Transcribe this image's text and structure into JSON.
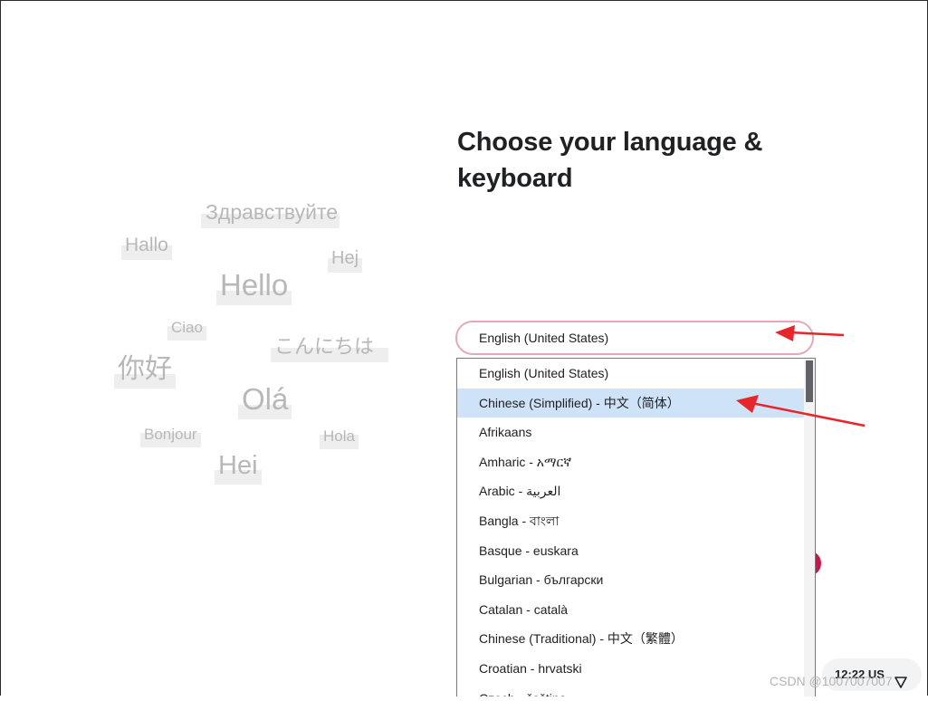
{
  "page": {
    "title": "Choose your language & keyboard"
  },
  "greetings": [
    {
      "text": "Здравствуйте"
    },
    {
      "text": "Hallo"
    },
    {
      "text": "Hej"
    },
    {
      "text": "Hello"
    },
    {
      "text": "Ciao"
    },
    {
      "text": "こんにちは"
    },
    {
      "text": "你好"
    },
    {
      "text": "Olá"
    },
    {
      "text": "Bonjour"
    },
    {
      "text": "Hola"
    },
    {
      "text": "Hei"
    }
  ],
  "language_select": {
    "value": "English (United States)"
  },
  "dropdown": {
    "options": [
      "English (United States)",
      "Chinese (Simplified) - 中文（简体）",
      "Afrikaans",
      "Amharic - አማርኛ",
      "Arabic - العربية",
      "Bangla - বাংলা",
      "Basque - euskara",
      "Bulgarian - български",
      "Catalan - català",
      "Chinese (Traditional) - 中文（繁體）",
      "Croatian - hrvatski",
      "Czech - čeština"
    ],
    "highlighted": "Chinese (Simplified) - 中文（简体）"
  },
  "status_tray": {
    "time": "12:22",
    "input_method": "US",
    "network_icon": "wifi-icon"
  },
  "watermark": {
    "text": "CSDN @1007007007"
  },
  "colors": {
    "accent": "#d6104b",
    "select_border": "#e8a6bb",
    "highlight": "#cfe3f8",
    "annotation_arrow": "#e8262a"
  }
}
